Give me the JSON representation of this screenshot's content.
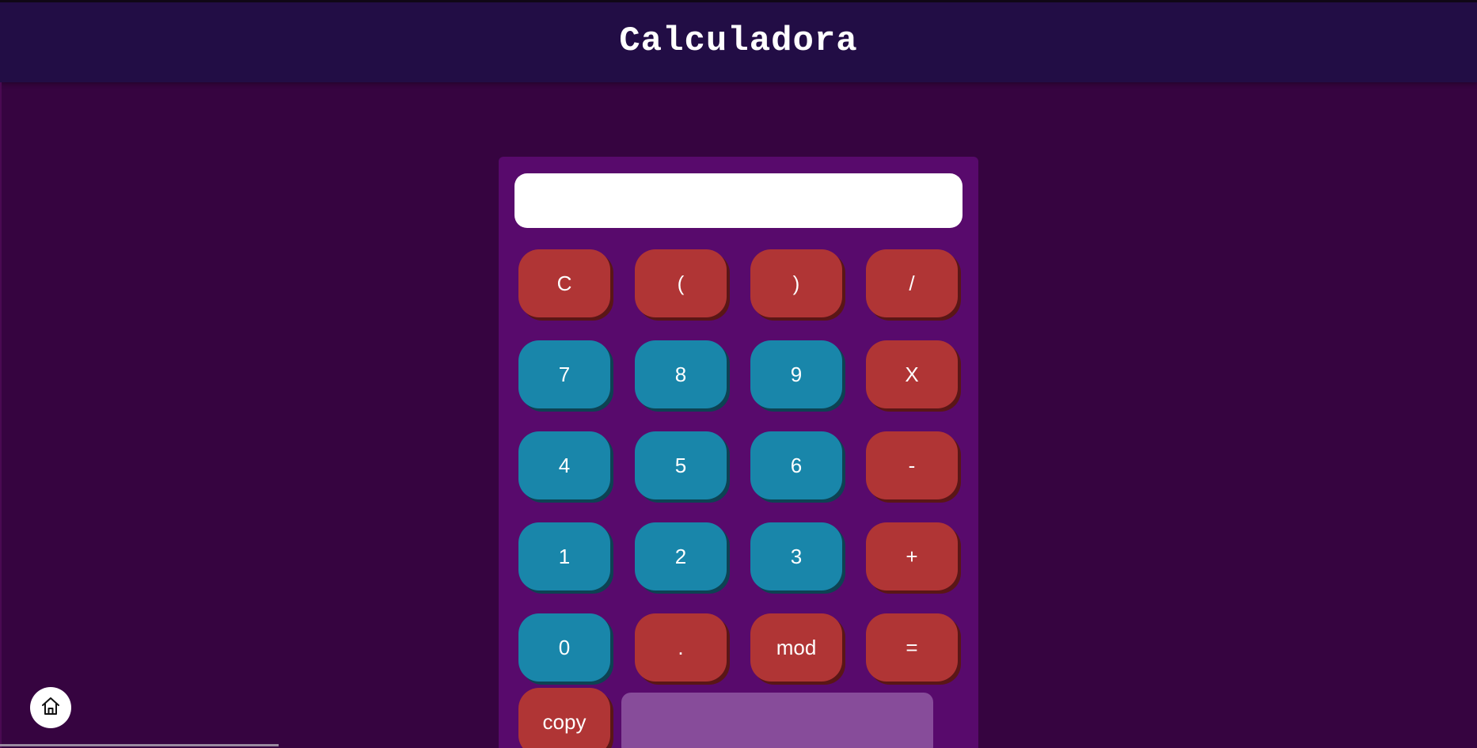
{
  "app": {
    "title": "Calculadora"
  },
  "display": {
    "value": "",
    "placeholder": ""
  },
  "keypad": {
    "clear": "C",
    "open_paren": "(",
    "close_paren": ")",
    "divide": "/",
    "seven": "7",
    "eight": "8",
    "nine": "9",
    "multiply": "X",
    "four": "4",
    "five": "5",
    "six": "6",
    "subtract": "-",
    "one": "1",
    "two": "2",
    "three": "3",
    "add": "+",
    "zero": "0",
    "decimal": ".",
    "mod": "mod",
    "equals": "="
  },
  "actions": {
    "copy": "copy"
  },
  "icons": {
    "home": "home-icon"
  },
  "colors": {
    "background": "#360440",
    "header": "#220d45",
    "calculator_body": "#580a6c",
    "operator_button": "#b03535",
    "digit_button": "#1986aa",
    "history_panel": "#874c9a"
  }
}
